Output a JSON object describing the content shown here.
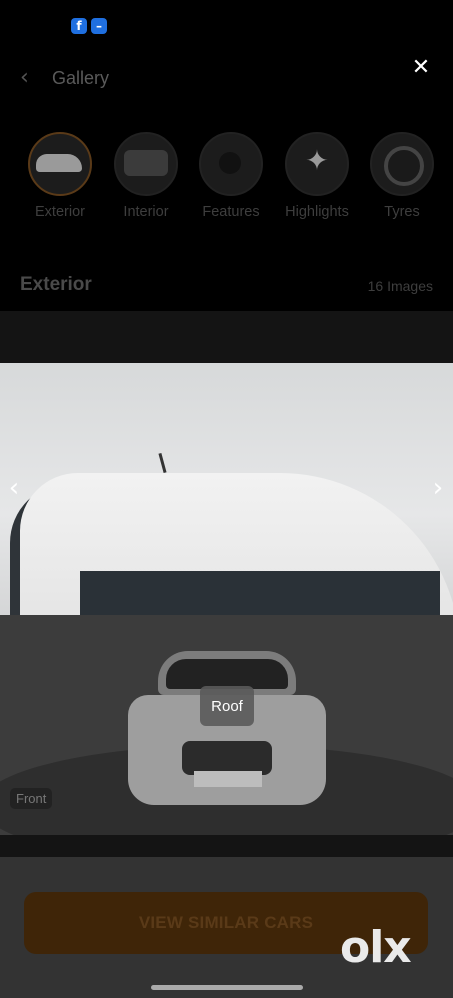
{
  "status": {
    "icons": [
      "facebook-icon",
      "messenger-icon"
    ]
  },
  "header": {
    "title": "Gallery",
    "close_icon": "close-icon",
    "back_icon": "chevron-left-icon"
  },
  "categories": [
    {
      "label": "Exterior",
      "active": true
    },
    {
      "label": "Interior",
      "active": false
    },
    {
      "label": "Features",
      "active": false
    },
    {
      "label": "Highlights",
      "active": false
    },
    {
      "label": "Tyres",
      "active": false
    }
  ],
  "section": {
    "title": "Exterior",
    "count": "16 Images"
  },
  "viewer": {
    "prev_icon": "chevron-left-icon",
    "next_icon": "chevron-right-icon",
    "current_view": "Roof",
    "badge": "Front"
  },
  "cta": {
    "label": "VIEW SIMILAR CARS"
  },
  "brand": {
    "logo_text": "olx"
  },
  "colors": {
    "accent": "#3f2508",
    "background": "#000000"
  }
}
